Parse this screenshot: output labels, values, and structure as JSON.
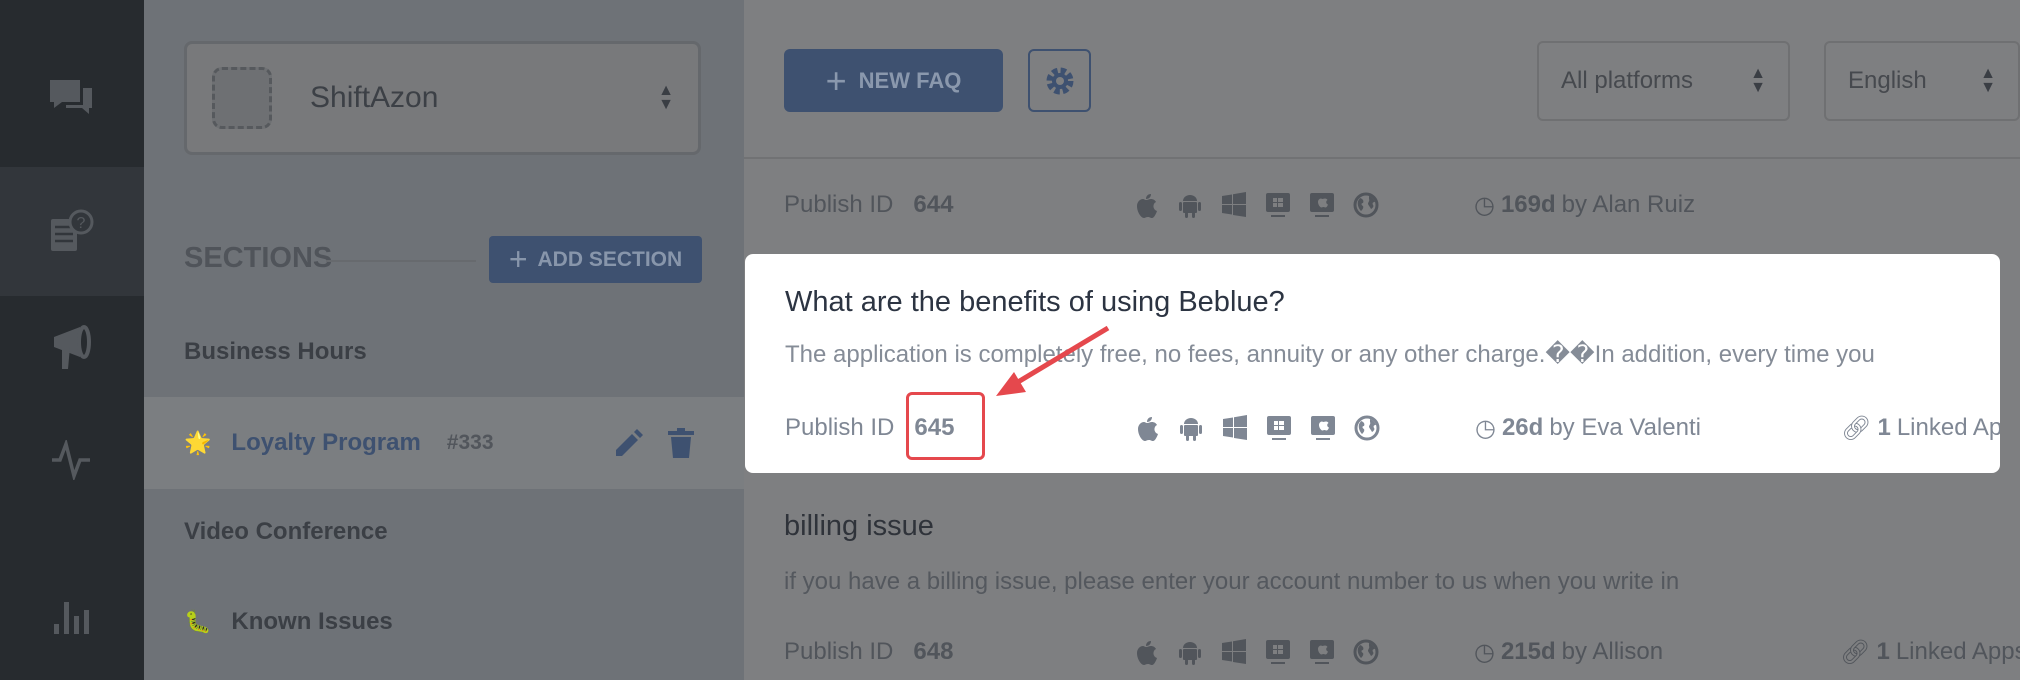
{
  "nav": {
    "items": [
      {
        "icon": "chat-icon"
      },
      {
        "icon": "faq-icon",
        "active": true
      },
      {
        "icon": "megaphone-icon"
      },
      {
        "icon": "activity-icon"
      },
      {
        "icon": "bar-chart-icon"
      }
    ]
  },
  "sidebar": {
    "app_name": "ShiftAzon",
    "sections_label": "SECTIONS",
    "add_section_label": "ADD SECTION",
    "sections": [
      {
        "emoji": "",
        "name": "Business Hours"
      },
      {
        "emoji": "🌟",
        "name": "Loyalty Program",
        "id": "#333",
        "active": true
      },
      {
        "emoji": "",
        "name": "Video Conference"
      },
      {
        "emoji": "🐛",
        "name": "Known Issues"
      }
    ]
  },
  "toolbar": {
    "new_faq_label": "NEW FAQ",
    "platform_filter": "All platforms",
    "language": "English"
  },
  "faqs": [
    {
      "publish_label": "Publish ID",
      "id": "644",
      "age": "169d",
      "author": "by Alan Ruiz"
    },
    {
      "title": "What are the benefits of using Beblue?",
      "description": "The application is completely free, no fees, annuity or any other charge.��In addition, every time you",
      "publish_label": "Publish ID",
      "id": "645",
      "age": "26d",
      "author": "by Eva Valenti",
      "linked_count": "1",
      "linked_label": "Linked Apps",
      "highlighted": true
    },
    {
      "title": "billing issue",
      "description": "if you have a billing issue, please enter your account number to us when you write in",
      "publish_label": "Publish ID",
      "id": "648",
      "age": "215d",
      "author": "by Allison",
      "linked_count": "1",
      "linked_label": "Linked Apps"
    }
  ],
  "platform_icons": [
    "apple-icon",
    "android-icon",
    "windows-icon",
    "windows-desktop-icon",
    "mac-desktop-icon",
    "web-globe-icon"
  ],
  "colors": {
    "accent": "#3e5170",
    "highlight": "#e5484d",
    "card_title": "#2c3442"
  }
}
